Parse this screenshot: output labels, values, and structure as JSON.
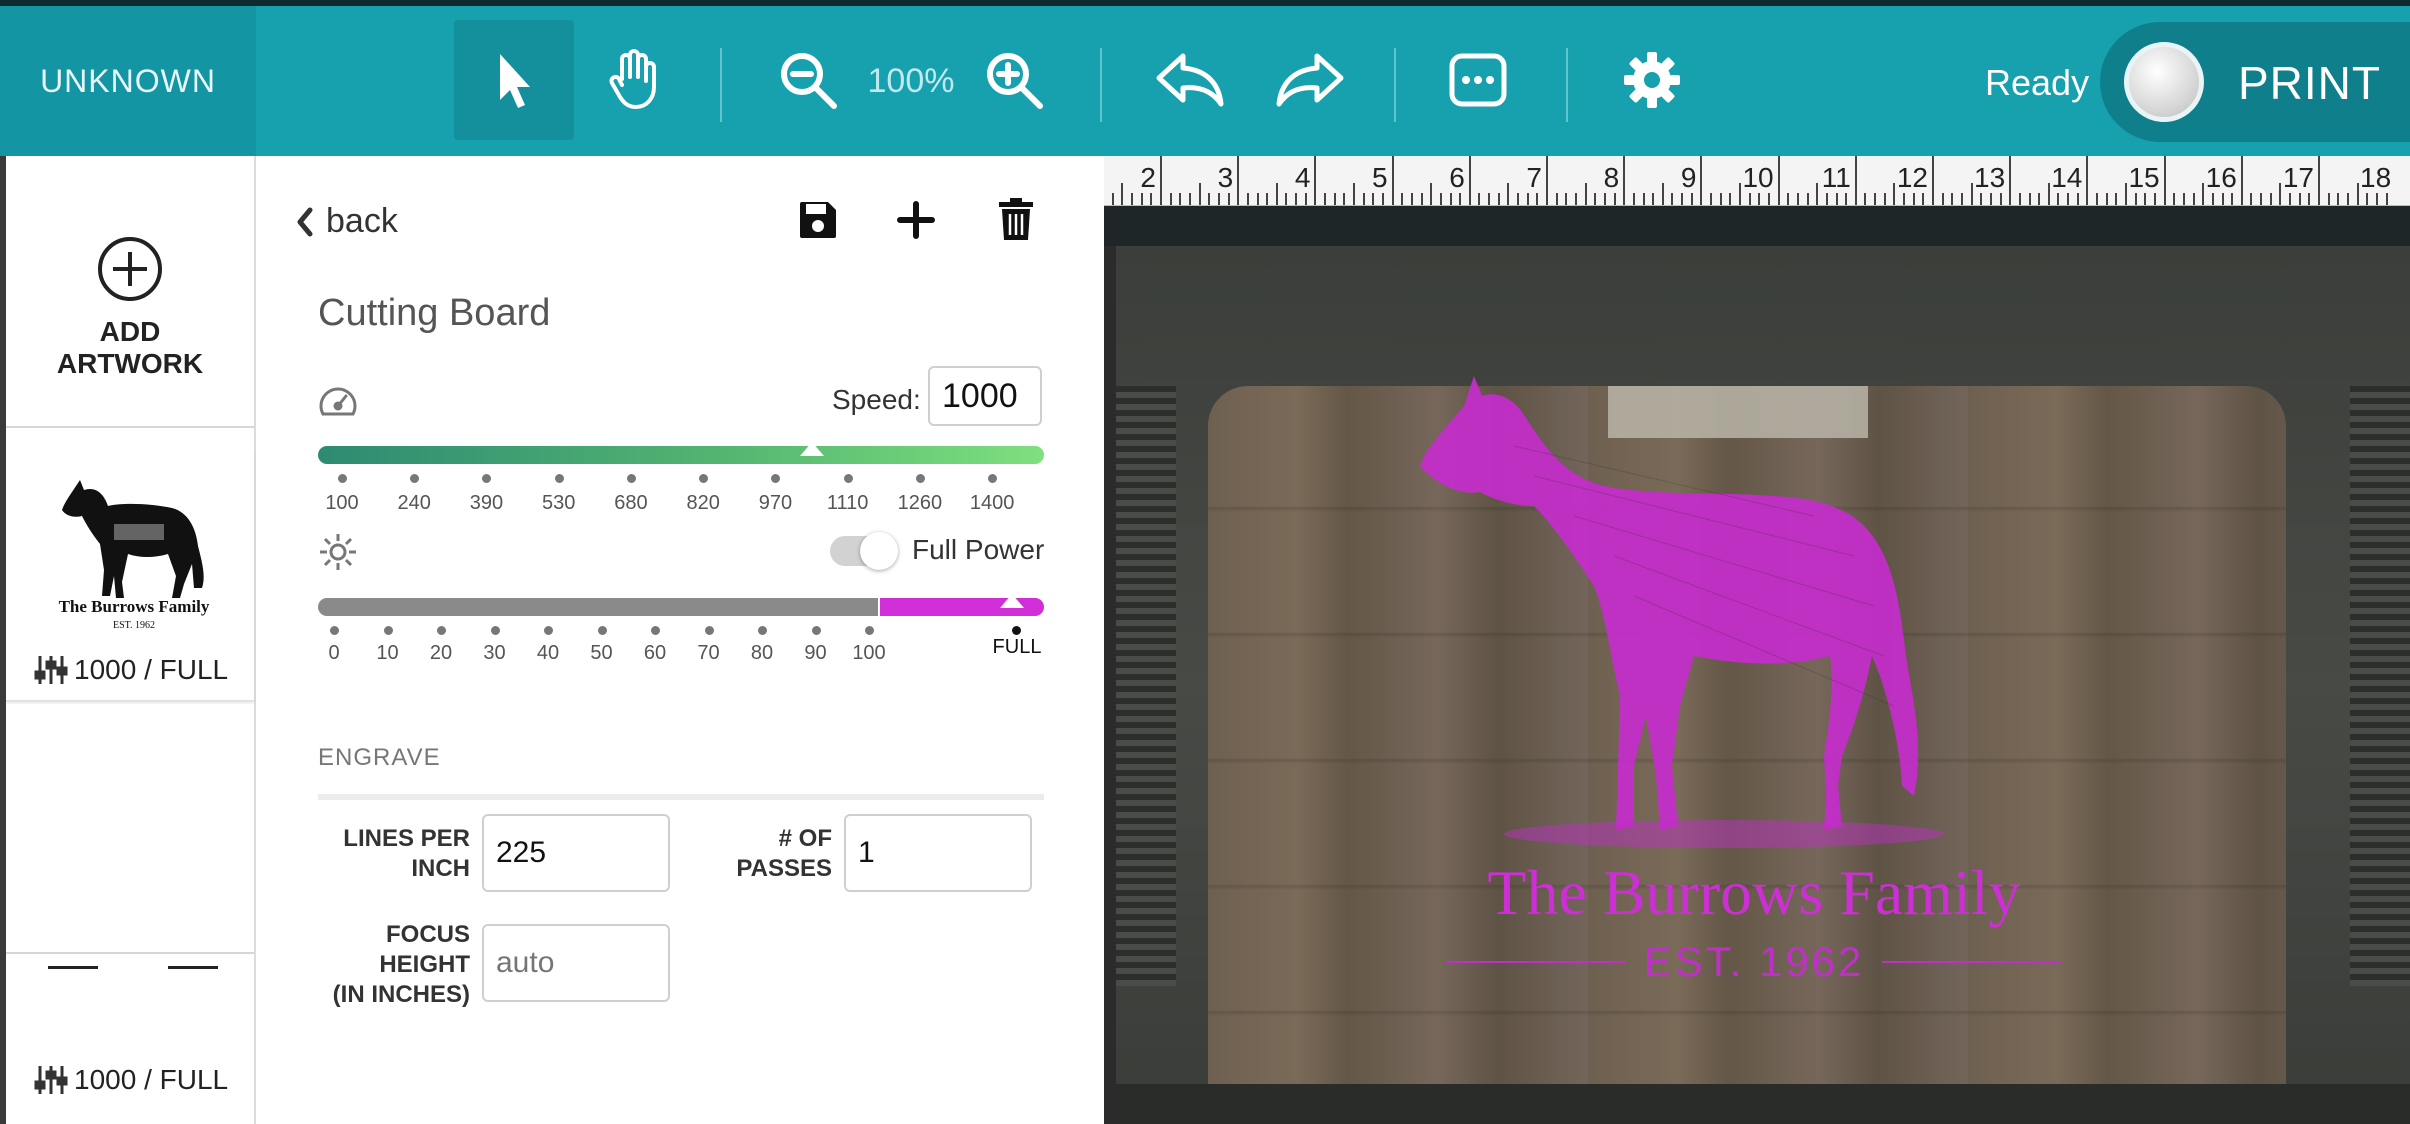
{
  "topbar": {
    "brand": "UNKNOWN",
    "zoom": "100%",
    "status": "Ready",
    "print_label": "PRINT",
    "tools": [
      "select-icon",
      "hand-icon",
      "zoom-out-icon",
      "zoom-in-icon",
      "undo-icon",
      "redo-icon",
      "more-icon",
      "gear-icon"
    ]
  },
  "artwork_list": {
    "add_label": "ADD\nARTWORK",
    "items": [
      {
        "thumb_title": "The Burrows Family",
        "thumb_sub": "EST. 1962",
        "settings": "1000 / FULL"
      },
      {
        "settings": "1000 / FULL"
      }
    ]
  },
  "panel": {
    "back_label": "back",
    "title": "Cutting Board",
    "speed_label": "Speed:",
    "speed_value": "1000",
    "speed_ticks": [
      "100",
      "240",
      "390",
      "530",
      "680",
      "820",
      "970",
      "1110",
      "1260",
      "1400"
    ],
    "speed_fraction": 0.68,
    "power_toggle_label": "Full Power",
    "power_on": true,
    "power_ticks": [
      "0",
      "10",
      "20",
      "30",
      "40",
      "50",
      "60",
      "70",
      "80",
      "90",
      "100"
    ],
    "power_full_label": "FULL",
    "section_label": "ENGRAVE",
    "lines_per_inch_label": "LINES PER\nINCH",
    "lines_per_inch_value": "225",
    "passes_label": "# OF\nPASSES",
    "passes_value": "1",
    "focus_label": "FOCUS\nHEIGHT\n(IN INCHES)",
    "focus_placeholder": "auto"
  },
  "canvas": {
    "ruler": [
      "2",
      "3",
      "4",
      "5",
      "6",
      "7",
      "8",
      "9",
      "10",
      "11",
      "12",
      "13",
      "14",
      "15",
      "16",
      "17",
      "18"
    ],
    "engrave_title": "The Burrows Family",
    "engrave_sub": "EST. 1962"
  },
  "colors": {
    "accent": "#17a0ad",
    "speed_gradient_start": "#2e8a72",
    "speed_gradient_end": "#7ee07e",
    "power_full": "#d02fd8",
    "engrave": "#cc2fd4"
  }
}
